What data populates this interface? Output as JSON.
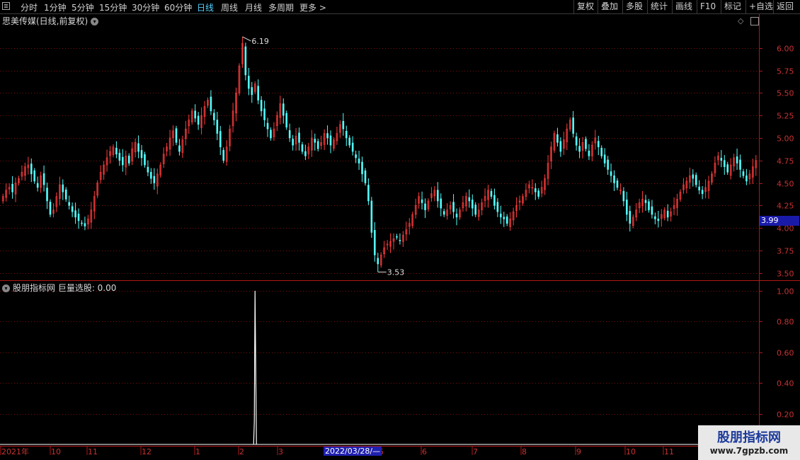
{
  "toolbar": {
    "periods": [
      "分时",
      "1分钟",
      "5分钟",
      "15分钟",
      "30分钟",
      "60分钟",
      "日线",
      "周线",
      "月线",
      "多周期",
      "更多 >"
    ],
    "active": "日线",
    "right_buttons": [
      "复权",
      "叠加",
      "多股",
      "统计",
      "画线",
      "F10",
      "标记",
      "+自选",
      "返回"
    ]
  },
  "stock": {
    "title": "思美传媒(日线,前复权)",
    "current_price": "3.99"
  },
  "indicator": {
    "title": "股朋指标网  巨量选股: 0.00"
  },
  "annotations": {
    "high": "6.19",
    "low": "3.53"
  },
  "cursor_date": "2022/03/28/—",
  "watermark": {
    "line1": "股朋指标网",
    "line2": "www.7gpzb.com"
  },
  "colors": {
    "up": "#ff3c3c",
    "down": "#54ffff",
    "grid": "#7a1010",
    "axis": "#b01818",
    "active": "#4fd0ff"
  },
  "chart_data": {
    "type": "candlestick",
    "price_axis": {
      "ticks": [
        6.0,
        5.75,
        5.5,
        5.25,
        5.0,
        4.75,
        4.5,
        4.25,
        4.0,
        3.75,
        3.5
      ],
      "labels": [
        "6.00",
        "5.75",
        "5.50",
        "5.25",
        "5.00",
        "4.75",
        "4.50",
        "4.25",
        "4.00",
        "3.75",
        "3.50"
      ],
      "ylim": [
        3.45,
        6.25
      ]
    },
    "indicator_axis": {
      "ticks": [
        1.0,
        0.8,
        0.6,
        0.4,
        0.2
      ],
      "labels": [
        "1.00",
        "0.80",
        "0.60",
        "0.40",
        "0.20"
      ],
      "ylim": [
        0,
        1.05
      ]
    },
    "x_labels": [
      "2021年",
      "10",
      "11",
      "12",
      "1",
      "2",
      "3",
      "5",
      "6",
      "7",
      "8",
      "9",
      "10",
      "11"
    ],
    "closes": [
      4.35,
      4.42,
      4.45,
      4.4,
      4.5,
      4.55,
      4.62,
      4.68,
      4.7,
      4.6,
      4.52,
      4.45,
      4.58,
      4.48,
      4.3,
      4.15,
      4.2,
      4.35,
      4.48,
      4.4,
      4.32,
      4.25,
      4.18,
      4.12,
      4.08,
      4.05,
      4.02,
      4.1,
      4.2,
      4.35,
      4.5,
      4.62,
      4.7,
      4.78,
      4.85,
      4.9,
      4.82,
      4.75,
      4.7,
      4.8,
      4.72,
      4.88,
      4.95,
      4.85,
      4.78,
      4.7,
      4.62,
      4.55,
      4.5,
      4.6,
      4.7,
      4.82,
      4.9,
      5.0,
      5.08,
      4.95,
      4.85,
      4.98,
      5.1,
      5.2,
      5.3,
      5.22,
      5.15,
      5.25,
      5.35,
      5.42,
      5.3,
      5.2,
      5.05,
      4.9,
      4.75,
      4.9,
      5.1,
      5.3,
      5.5,
      5.8,
      6.05,
      5.7,
      5.55,
      5.48,
      5.6,
      5.42,
      5.3,
      5.2,
      5.1,
      5.0,
      5.1,
      5.25,
      5.38,
      5.25,
      5.12,
      5.0,
      4.92,
      5.02,
      4.95,
      4.85,
      4.8,
      4.9,
      5.0,
      4.95,
      4.88,
      4.95,
      5.05,
      5.0,
      4.92,
      4.98,
      5.05,
      5.15,
      5.1,
      5.0,
      4.92,
      4.85,
      4.78,
      4.72,
      4.6,
      4.5,
      4.3,
      3.95,
      3.7,
      3.6,
      3.7,
      3.78,
      3.82,
      3.85,
      3.88,
      3.9,
      3.86,
      3.92,
      3.98,
      4.05,
      4.15,
      4.25,
      4.35,
      4.28,
      4.2,
      4.3,
      4.38,
      4.42,
      4.3,
      4.22,
      4.15,
      4.2,
      4.25,
      4.18,
      4.12,
      4.2,
      4.28,
      4.35,
      4.3,
      4.22,
      4.15,
      4.2,
      4.28,
      4.35,
      4.42,
      4.35,
      4.25,
      4.18,
      4.12,
      4.1,
      4.05,
      4.1,
      4.18,
      4.25,
      4.3,
      4.35,
      4.42,
      4.48,
      4.45,
      4.4,
      4.35,
      4.45,
      4.55,
      4.72,
      4.9,
      5.05,
      4.95,
      4.85,
      4.98,
      5.1,
      5.2,
      5.05,
      4.92,
      4.85,
      4.95,
      4.88,
      4.8,
      4.92,
      5.0,
      4.9,
      4.8,
      4.72,
      4.65,
      4.58,
      4.5,
      4.45,
      4.42,
      4.3,
      4.15,
      4.05,
      4.12,
      4.2,
      4.28,
      4.32,
      4.28,
      4.2,
      4.15,
      4.1,
      4.08,
      4.15,
      4.2,
      4.12,
      4.18,
      4.25,
      4.32,
      4.4,
      4.48,
      4.52,
      4.58,
      4.55,
      4.48,
      4.42,
      4.38,
      4.45,
      4.52,
      4.6,
      4.72,
      4.8,
      4.75,
      4.68,
      4.62,
      4.7,
      4.78,
      4.72,
      4.65,
      4.58,
      4.52,
      4.6,
      4.68,
      4.75
    ],
    "spike": {
      "index": 80,
      "value": 1.0
    }
  }
}
